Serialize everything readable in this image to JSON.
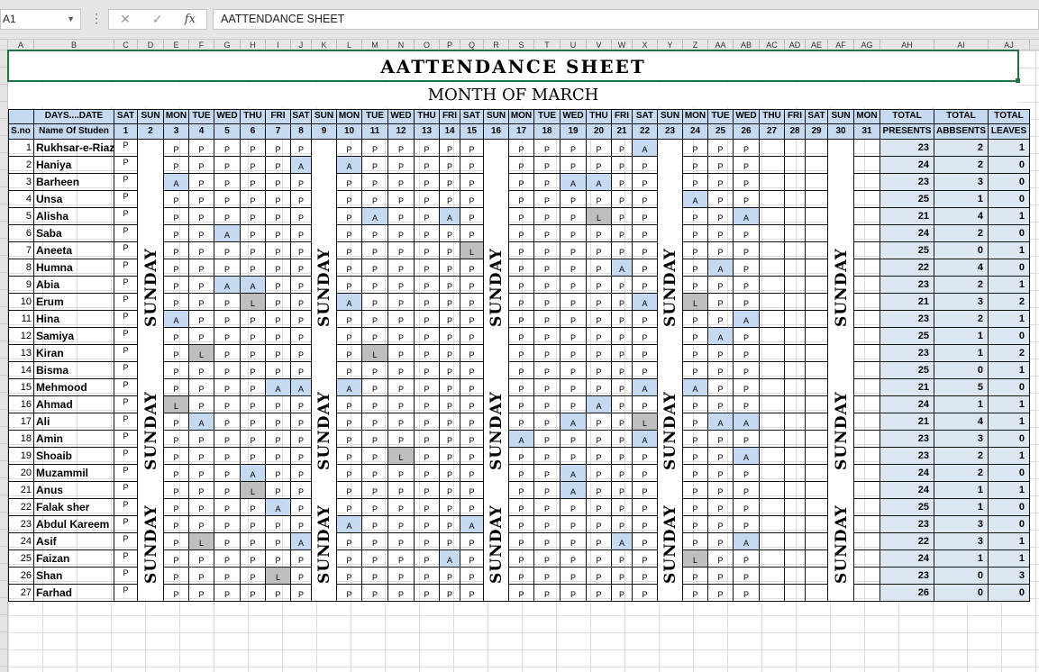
{
  "formula_bar": {
    "name_box": "A1",
    "formula": "AATTENDANCE SHEET",
    "cancel_icon": "✕",
    "enter_icon": "✓",
    "fx_icon": "fx"
  },
  "columns": [
    "A",
    "B",
    "C",
    "D",
    "E",
    "F",
    "G",
    "H",
    "I",
    "J",
    "K",
    "L",
    "M",
    "N",
    "O",
    "P",
    "Q",
    "R",
    "S",
    "T",
    "U",
    "V",
    "W",
    "X",
    "Y",
    "Z",
    "AA",
    "AB",
    "AC",
    "AD",
    "AE",
    "AF",
    "AG",
    "AH",
    "AI",
    "AJ"
  ],
  "sheet": {
    "title": "AATTENDANCE SHEET",
    "month": "MONTH OF MARCH",
    "days_label": "DAYS....DATE",
    "sno_label": "S.no",
    "name_label": "Name Of Studen",
    "sunday_label": "SUNDAY",
    "days": [
      "SAT",
      "SUN",
      "MON",
      "TUE",
      "WED",
      "THU",
      "FRI",
      "SAT",
      "SUN",
      "MON",
      "TUE",
      "WED",
      "THU",
      "FRI",
      "SAT",
      "SUN",
      "MON",
      "TUE",
      "WED",
      "THU",
      "FRI",
      "SAT",
      "SUN",
      "MON",
      "TUE",
      "WED",
      "THU",
      "FRI",
      "SAT",
      "SUN",
      "MON"
    ],
    "dates": [
      "1",
      "2",
      "3",
      "4",
      "5",
      "6",
      "7",
      "8",
      "9",
      "10",
      "11",
      "12",
      "13",
      "14",
      "15",
      "16",
      "17",
      "18",
      "19",
      "20",
      "21",
      "22",
      "23",
      "24",
      "25",
      "26",
      "27",
      "28",
      "29",
      "30",
      "31"
    ],
    "total_headers": [
      [
        "TOTAL",
        "PRESENTS"
      ],
      [
        "TOTAL",
        "ABBSENTS"
      ],
      [
        "TOTAL",
        "LEAVES"
      ]
    ],
    "students": [
      {
        "sno": "1",
        "name": "Rukhsar-e-Riaz",
        "att": "P PPPPPP PLPPPP PPAPPP PPAPPP P",
        "totals": [
          "23",
          "2",
          "1"
        ]
      },
      {
        "sno": "2",
        "name": "Haniya",
        "att": "P PPPPPP APAPPP PPPPPP PPPPPP P",
        "totals": [
          "24",
          "2",
          "0"
        ]
      },
      {
        "sno": "3",
        "name": "Barheen",
        "att": "P PAPPPP PPPPPP PPPPPA APPPPP P",
        "totals": [
          "23",
          "3",
          "0"
        ]
      },
      {
        "sno": "4",
        "name": "Unsa",
        "att": "P PPPPPP PPPPPP PPPPPP PPPPAP P",
        "totals": [
          "25",
          "1",
          "0"
        ]
      },
      {
        "sno": "5",
        "name": "Alisha",
        "att": "P PPPPPP PAPAPP APPPPP LPPPPP A",
        "totals": [
          "21",
          "4",
          "1"
        ]
      },
      {
        "sno": "6",
        "name": "Saba",
        "att": "P APPAPP PPPPPP PPPPPP PPPPPP P",
        "totals": [
          "24",
          "2",
          "0"
        ]
      },
      {
        "sno": "7",
        "name": "Aneeta",
        "att": "P PPPPPP PPPPPP PLPPPP PPPPPP P",
        "totals": [
          "25",
          "0",
          "1"
        ]
      },
      {
        "sno": "8",
        "name": "Humna",
        "att": "P PPPPPP PPPPPP PPAPPP PAPAPA P",
        "totals": [
          "22",
          "4",
          "0"
        ]
      },
      {
        "sno": "9",
        "name": "Abia",
        "att": "P LPPAAP PPPPPP PPPPPP PPPPPP P",
        "totals": [
          "23",
          "2",
          "1"
        ]
      },
      {
        "sno": "10",
        "name": "Erum",
        "att": "P APPPLP PPAPPP PPPPPP PPAPLP P",
        "totals": [
          "21",
          "3",
          "2"
        ]
      },
      {
        "sno": "11",
        "name": "Hina",
        "att": "P PAPPPP PPPPPP PPLPPP PPPPPP A",
        "totals": [
          "23",
          "2",
          "1"
        ]
      },
      {
        "sno": "12",
        "name": "Samiya",
        "att": "P PPPPPP PPPPPP PPPPPP PPPPPA P",
        "totals": [
          "25",
          "1",
          "0"
        ]
      },
      {
        "sno": "13",
        "name": "Kiran",
        "att": "P PPLPPP PAPLPP PPPPPP PPPPPP P",
        "totals": [
          "23",
          "1",
          "2"
        ]
      },
      {
        "sno": "14",
        "name": "Bisma",
        "att": "P PPPPPP PPPPPP PPLPPP PPPPPP P",
        "totals": [
          "25",
          "0",
          "1"
        ]
      },
      {
        "sno": "15",
        "name": "Mehmood",
        "att": "P PPPPPA APAPPP PPPPPP PPAPAP P",
        "totals": [
          "21",
          "5",
          "0"
        ]
      },
      {
        "sno": "16",
        "name": "Ahmad",
        "att": "P PLPPPP PPPPPP PPPPPP APPPPP P",
        "totals": [
          "24",
          "1",
          "1"
        ]
      },
      {
        "sno": "17",
        "name": "Ali",
        "att": "P PPAPPP PPPPPP PPPPPA PPLPPA A",
        "totals": [
          "21",
          "4",
          "1"
        ]
      },
      {
        "sno": "18",
        "name": "Amin",
        "att": "P APPPPP PPPPPP PPPAPP PPAPPP P",
        "totals": [
          "23",
          "3",
          "0"
        ]
      },
      {
        "sno": "19",
        "name": "Shoaib",
        "att": "P PPPPPP PAPPLP PPPPPP PPPPPP A",
        "totals": [
          "23",
          "2",
          "1"
        ]
      },
      {
        "sno": "20",
        "name": "Muzammil",
        "att": "P PPPPAP PPPPPP PPPPPA PPPPPP P",
        "totals": [
          "24",
          "2",
          "0"
        ]
      },
      {
        "sno": "21",
        "name": "Anus",
        "att": "P PPPPLP PPPPPP PPPPPA PPPPPP P",
        "totals": [
          "24",
          "1",
          "1"
        ]
      },
      {
        "sno": "22",
        "name": "Falak sher",
        "att": "P PPPPPA PPPPPP PPPPPP PPPPPP P",
        "totals": [
          "25",
          "1",
          "0"
        ]
      },
      {
        "sno": "23",
        "name": "Abdul Kareem",
        "att": "P PPPPPP PPAPPP PAPPPP PPPAPP P",
        "totals": [
          "23",
          "3",
          "0"
        ]
      },
      {
        "sno": "24",
        "name": "Asif",
        "att": "P PPLPPP APPPPP PPPPPP PAPPPP A",
        "totals": [
          "22",
          "3",
          "1"
        ]
      },
      {
        "sno": "25",
        "name": "Faizan",
        "att": "P PPPPPP PPPPPP APPPPP PPPPLP P",
        "totals": [
          "24",
          "1",
          "1"
        ]
      },
      {
        "sno": "26",
        "name": "Shan",
        "att": "P LPPPPL PPPPPP PPPPPP PPPLPP P",
        "totals": [
          "23",
          "0",
          "3"
        ]
      },
      {
        "sno": "27",
        "name": "Farhad",
        "att": "P PPPPPP PPPPPP PPPPPP PPPPPP P",
        "totals": [
          "26",
          "0",
          "0"
        ]
      }
    ]
  },
  "colors": {
    "header_fill": "#c5d9f1",
    "absent_fill": "#c5d9f1",
    "leave_fill": "#bfbfbf",
    "totals_fill": "#dce6f1",
    "selection": "#217346"
  }
}
